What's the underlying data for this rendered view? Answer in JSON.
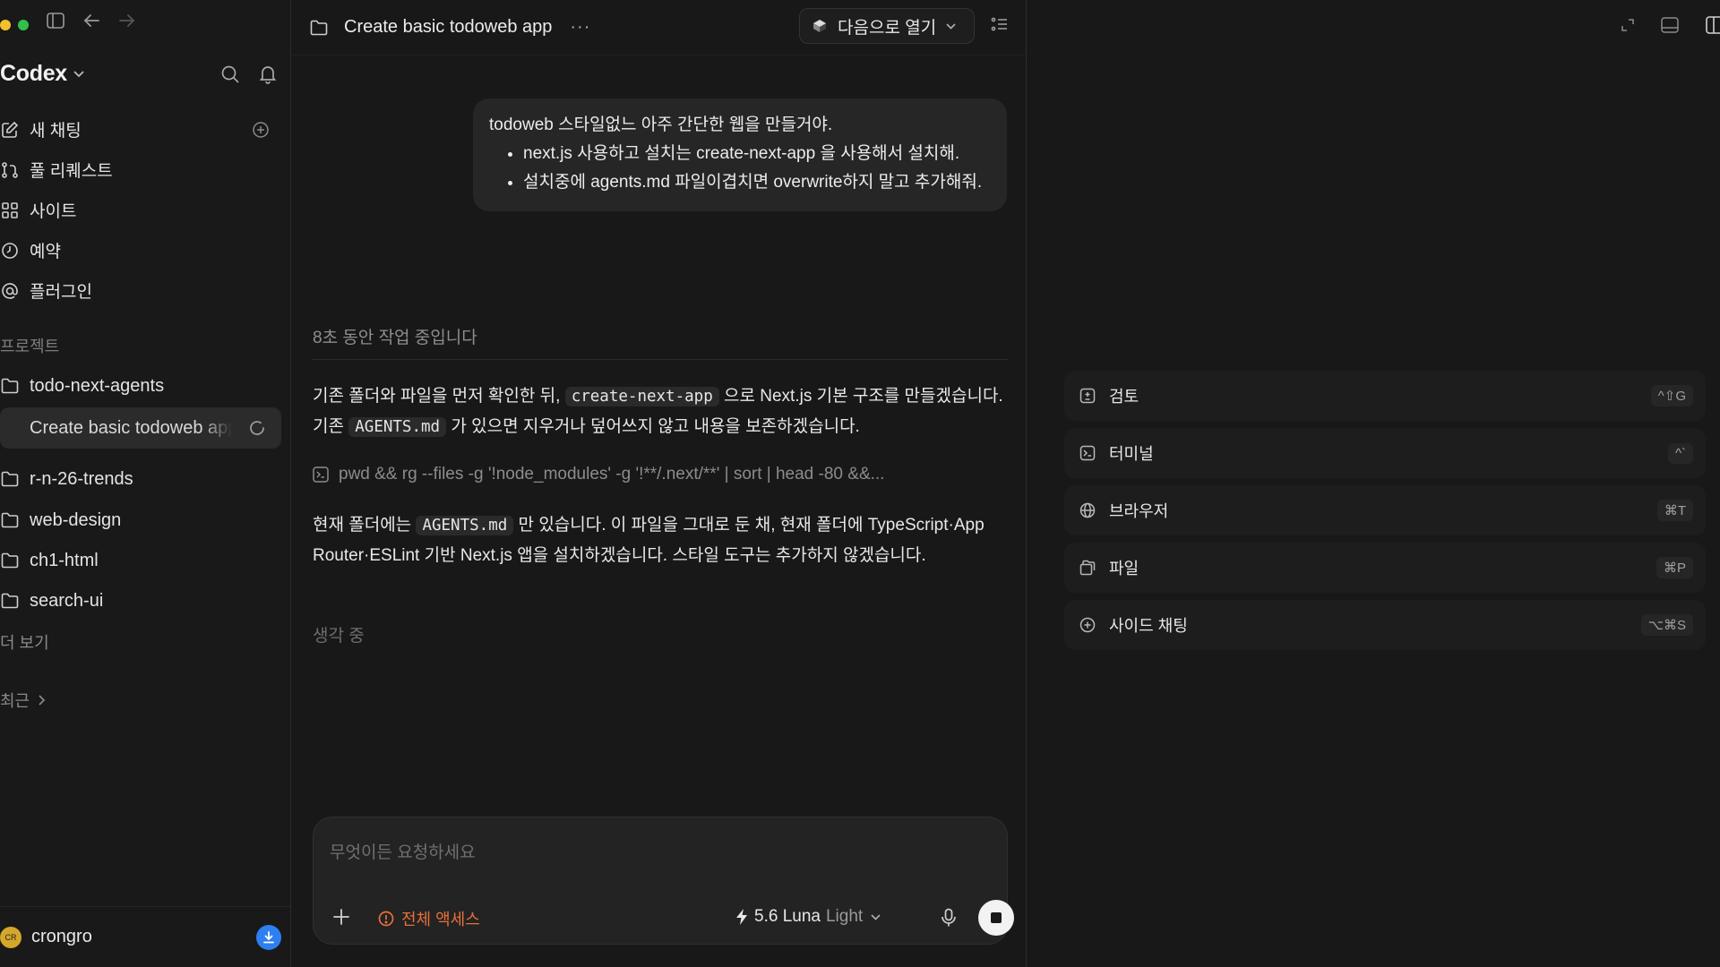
{
  "colors": {
    "traffic_yellow": "#f5c02c",
    "traffic_green": "#31c14b",
    "accent_orange": "#e8703a",
    "download_blue": "#2e7ff0"
  },
  "sidebar": {
    "brand": "Codex",
    "nav": [
      {
        "label": "새 채팅",
        "icon": "new-chat-icon"
      },
      {
        "label": "풀 리퀘스트",
        "icon": "pull-request-icon"
      },
      {
        "label": "사이트",
        "icon": "sites-icon"
      },
      {
        "label": "예약",
        "icon": "clock-icon"
      },
      {
        "label": "플러그인",
        "icon": "at-icon"
      }
    ],
    "projects_label": "프로젝트",
    "projects": [
      {
        "label": "todo-next-agents"
      },
      {
        "label": "Create basic todoweb app",
        "active": true
      },
      {
        "label": "r-n-26-trends"
      },
      {
        "label": "web-design"
      },
      {
        "label": "ch1-html"
      },
      {
        "label": "search-ui"
      }
    ],
    "more_label": "더 보기",
    "recent_label": "최근",
    "user": {
      "name": "crongro",
      "initials": "CR"
    }
  },
  "main": {
    "title": "Create basic todoweb app",
    "open_with_label": "다음으로 열기",
    "user_message": {
      "intro": "todoweb 스타일없느 아주 간단한 웹을 만들거야.",
      "bullets": [
        "next.js 사용하고 설치는 create-next-app 을 사용해서 설치해.",
        "설치중에 agents.md 파일이겹치면 overwrite하지 말고 추가해줘."
      ]
    },
    "working_status": "8초 동안 작업 중입니다",
    "para1": {
      "t1": "기존 폴더와 파일을 먼저 확인한 뒤, ",
      "c1": "create-next-app",
      "t2": " 으로 Next.js 기본 구조를 만들겠습니다. 기존 ",
      "c2": "AGENTS.md",
      "t3": " 가 있으면 지우거나 덮어쓰지 않고 내용을 보존하겠습니다."
    },
    "command": "pwd && rg --files -g '!node_modules' -g '!**/.next/**' | sort | head -80 &&...",
    "para2": {
      "t1": "현재 폴더에는 ",
      "c1": "AGENTS.md",
      "t2": " 만 있습니다. 이 파일을 그대로 둔 채, 현재 폴더에 TypeScript·App Router·ESLint 기반 Next.js 앱을 설치하겠습니다. 스타일 도구는 추가하지 않겠습니다."
    },
    "thinking": "생각 중",
    "composer": {
      "placeholder": "무엇이든 요청하세요",
      "access_label": "전체 액세스",
      "model_name": "5.6 Luna",
      "model_mode": "Light"
    }
  },
  "right_panel": {
    "tools": [
      {
        "label": "검토",
        "shortcut": "^⇧G",
        "icon": "review-icon"
      },
      {
        "label": "터미널",
        "shortcut": "^`",
        "icon": "terminal-icon"
      },
      {
        "label": "브라우저",
        "shortcut": "⌘T",
        "icon": "globe-icon"
      },
      {
        "label": "파일",
        "shortcut": "⌘P",
        "icon": "files-icon"
      },
      {
        "label": "사이드 채팅",
        "shortcut": "⌥⌘S",
        "icon": "side-chat-icon"
      }
    ]
  }
}
